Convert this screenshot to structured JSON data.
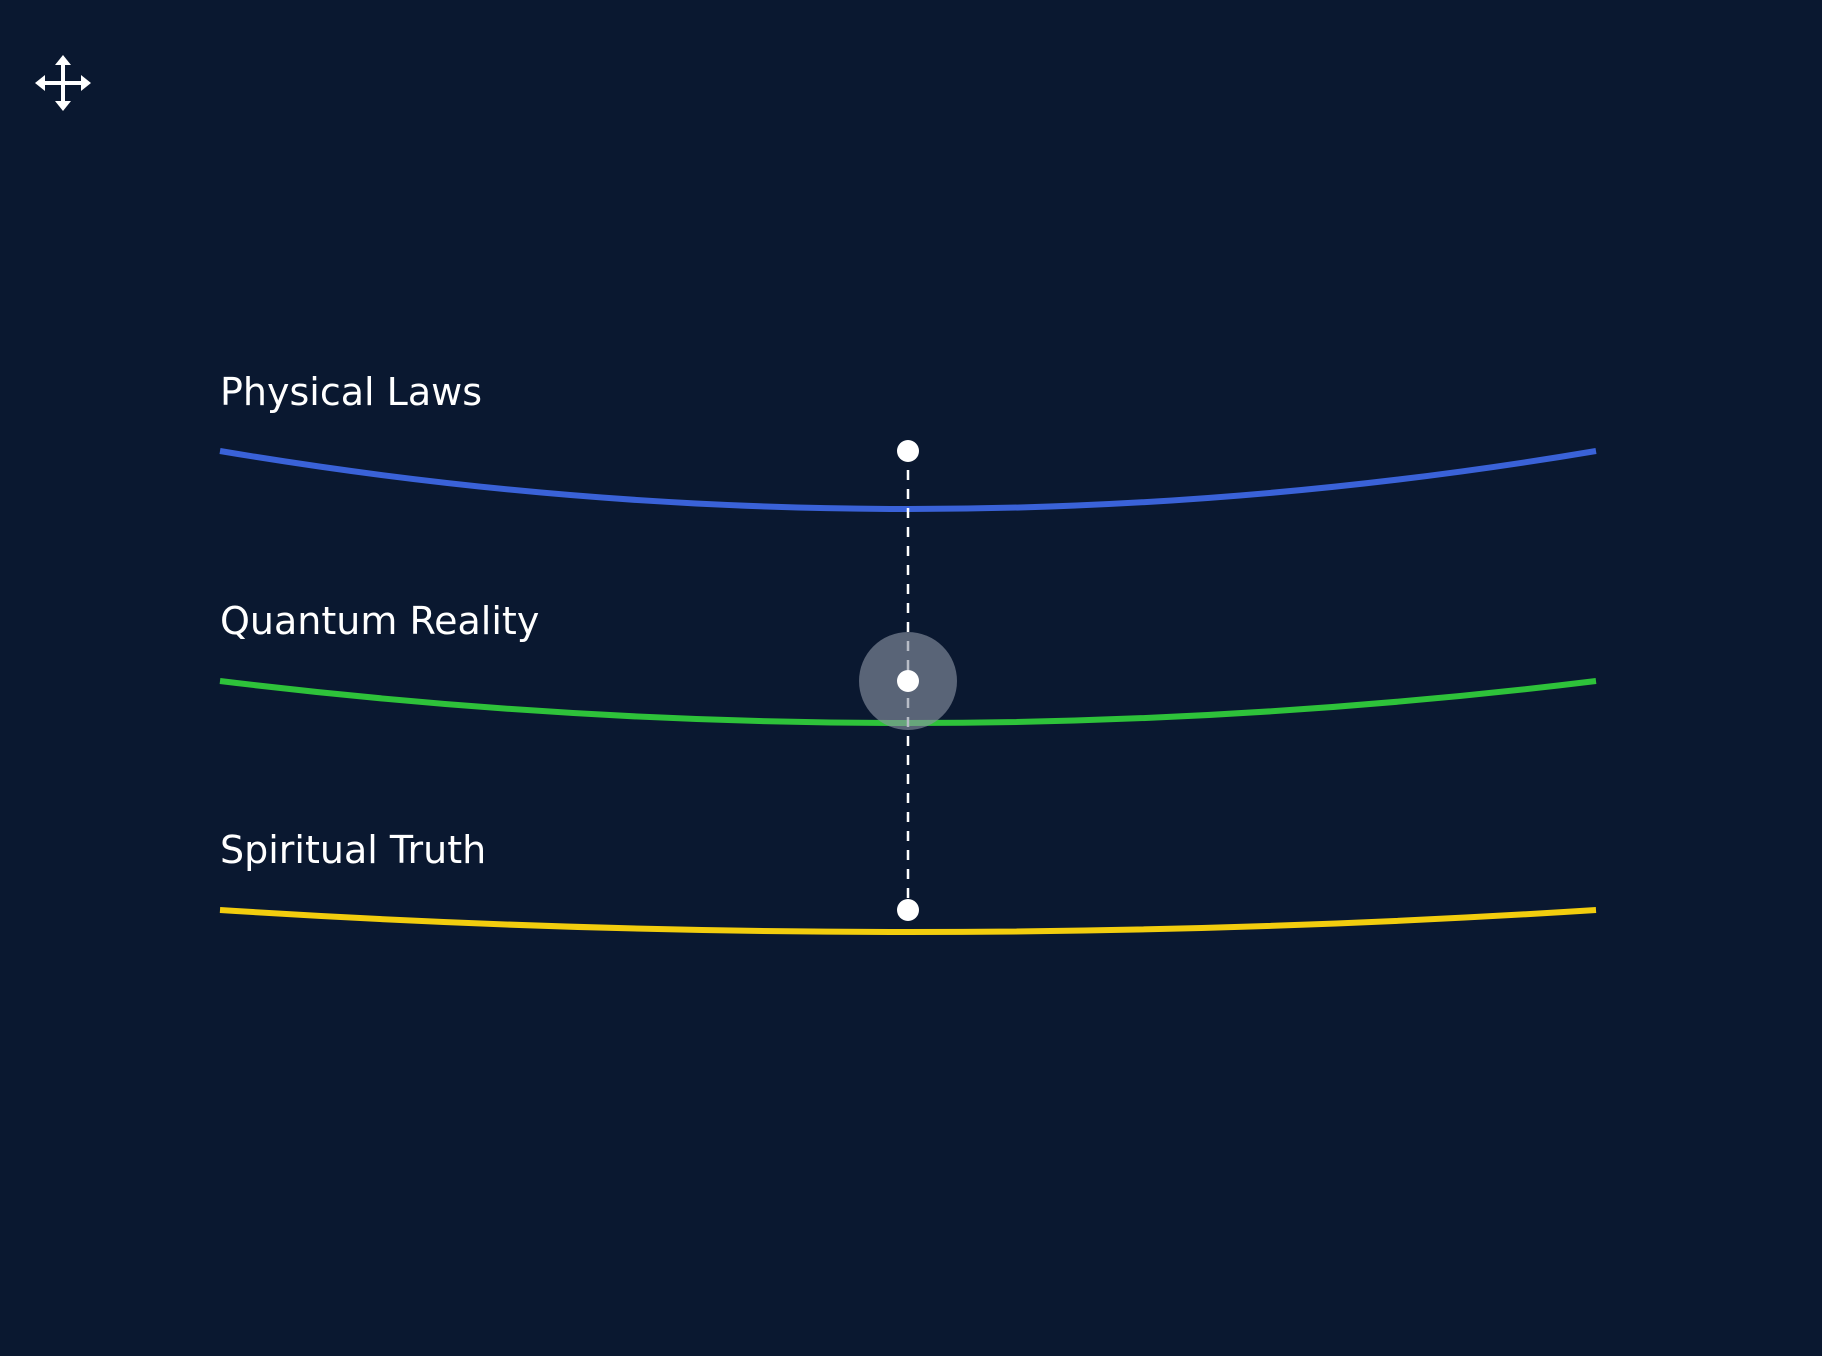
{
  "diagram": {
    "background": "#0a1830",
    "layers": [
      {
        "label": "Physical Laws",
        "color": "#3a62d8"
      },
      {
        "label": "Quantum Reality",
        "color": "#2ec23a"
      },
      {
        "label": "Spiritual Truth",
        "color": "#f2cd0e"
      }
    ],
    "connector": {
      "style": "dashed",
      "color": "#ffffff"
    },
    "focus_marker": {
      "layer": "Quantum Reality",
      "color": "#8a93a3"
    },
    "controls": {
      "move_icon": "move-arrows-icon"
    }
  }
}
